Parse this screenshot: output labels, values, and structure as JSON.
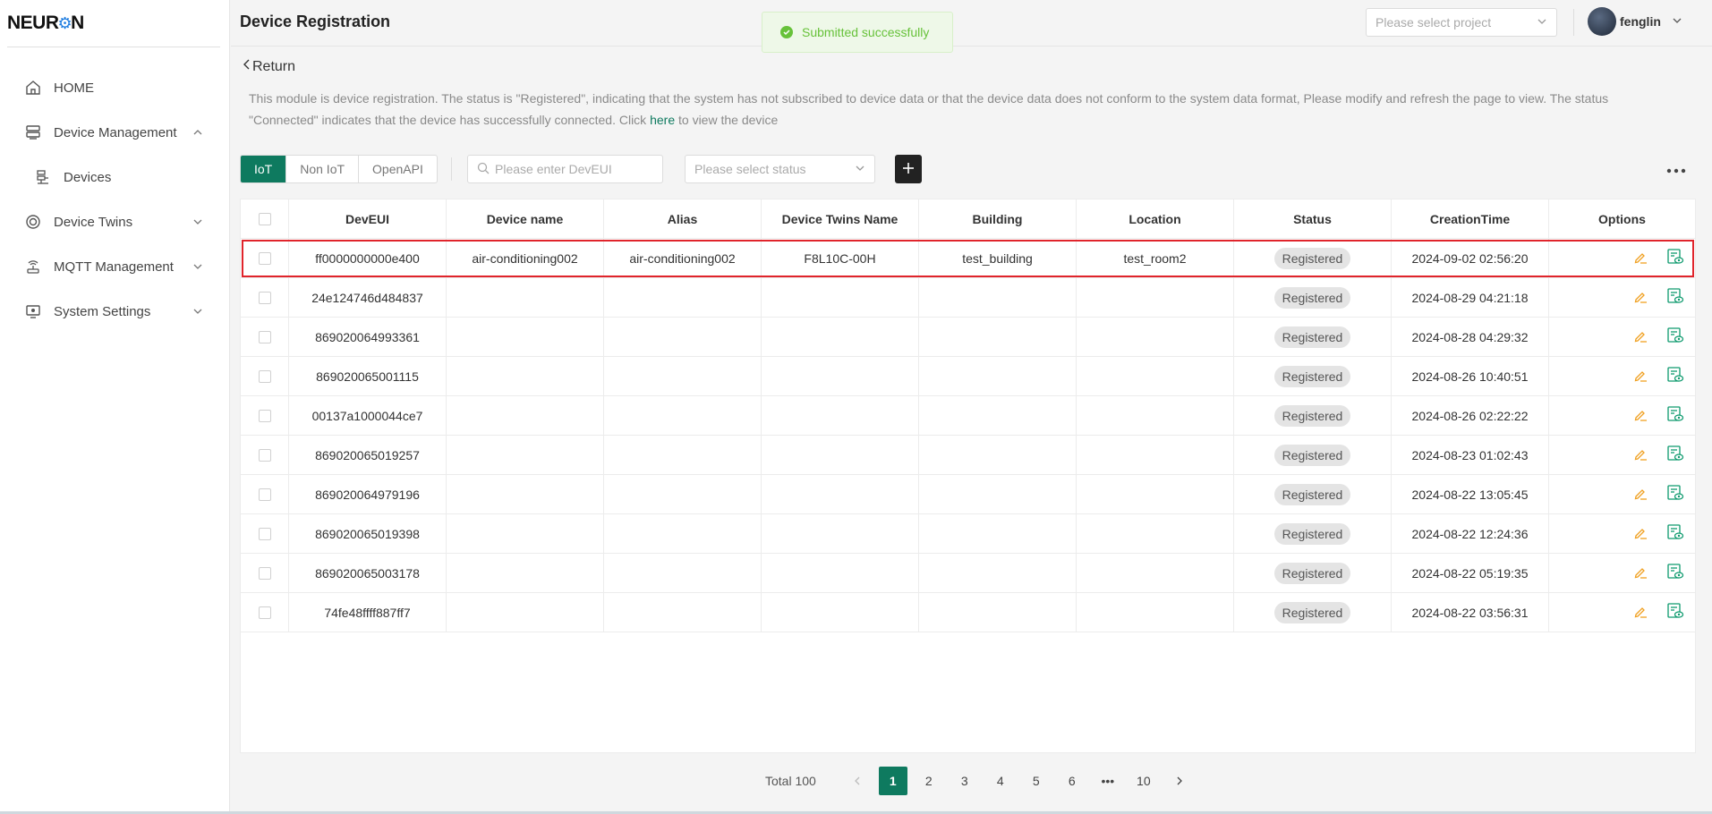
{
  "sidebar": {
    "logo": {
      "pre": "NEUR",
      "mark": "⚙",
      "post": "N"
    },
    "items": [
      {
        "label": "HOME",
        "icon": "home-icon"
      },
      {
        "label": "Device Management",
        "icon": "server-icon",
        "expanded": true
      },
      {
        "label": "Devices",
        "icon": "devices-icon",
        "sub": true
      },
      {
        "label": "Device Twins",
        "icon": "twins-icon"
      },
      {
        "label": "MQTT Management",
        "icon": "antenna-icon"
      },
      {
        "label": "System Settings",
        "icon": "monitor-icon"
      }
    ]
  },
  "header": {
    "title": "Device Registration",
    "project_placeholder": "Please select project",
    "username": "fenglin"
  },
  "toast": {
    "message": "Submitted successfully",
    "color": "#67c23a"
  },
  "content": {
    "back_label": "Return",
    "notice_pre": "This module is device registration. The status is \"Registered\", indicating that the system has not subscribed to device data or that the device data does not conform to the system data format, Please modify and refresh the page to view. The status \"Connected\" indicates that the device has successfully connected. Click ",
    "notice_link": "here",
    "notice_post": " to view the device"
  },
  "toolbar": {
    "tabs": [
      "IoT",
      "Non IoT",
      "OpenAPI"
    ],
    "active_tab": "IoT",
    "search_placeholder": "Please enter DevEUI",
    "status_placeholder": "Please select status"
  },
  "table": {
    "columns": [
      "DevEUI",
      "Device name",
      "Alias",
      "Device Twins Name",
      "Building",
      "Location",
      "Status",
      "CreationTime",
      "Options"
    ],
    "rows": [
      {
        "deveui": "ff0000000000e400",
        "name": "air-conditioning002",
        "alias": "air-conditioning002",
        "twins": "F8L10C-00H",
        "building": "test_building",
        "location": "test_room2",
        "status": "Registered",
        "time": "2024-09-02 02:56:20"
      },
      {
        "deveui": "24e124746d484837",
        "name": "",
        "alias": "",
        "twins": "",
        "building": "",
        "location": "",
        "status": "Registered",
        "time": "2024-08-29 04:21:18"
      },
      {
        "deveui": "869020064993361",
        "name": "",
        "alias": "",
        "twins": "",
        "building": "",
        "location": "",
        "status": "Registered",
        "time": "2024-08-28 04:29:32"
      },
      {
        "deveui": "869020065001115",
        "name": "",
        "alias": "",
        "twins": "",
        "building": "",
        "location": "",
        "status": "Registered",
        "time": "2024-08-26 10:40:51"
      },
      {
        "deveui": "00137a1000044ce7",
        "name": "",
        "alias": "",
        "twins": "",
        "building": "",
        "location": "",
        "status": "Registered",
        "time": "2024-08-26 02:22:22"
      },
      {
        "deveui": "869020065019257",
        "name": "",
        "alias": "",
        "twins": "",
        "building": "",
        "location": "",
        "status": "Registered",
        "time": "2024-08-23 01:02:43"
      },
      {
        "deveui": "869020064979196",
        "name": "",
        "alias": "",
        "twins": "",
        "building": "",
        "location": "",
        "status": "Registered",
        "time": "2024-08-22 13:05:45"
      },
      {
        "deveui": "869020065019398",
        "name": "",
        "alias": "",
        "twins": "",
        "building": "",
        "location": "",
        "status": "Registered",
        "time": "2024-08-22 12:24:36"
      },
      {
        "deveui": "869020065003178",
        "name": "",
        "alias": "",
        "twins": "",
        "building": "",
        "location": "",
        "status": "Registered",
        "time": "2024-08-22 05:19:35"
      },
      {
        "deveui": "74fe48ffff887ff7",
        "name": "",
        "alias": "",
        "twins": "",
        "building": "",
        "location": "",
        "status": "Registered",
        "time": "2024-08-22 03:56:31"
      }
    ],
    "highlighted_row": 0
  },
  "pagination": {
    "total_label": "Total 100",
    "pages": [
      "1",
      "2",
      "3",
      "4",
      "5",
      "6",
      "•••",
      "10"
    ],
    "current": "1"
  },
  "colors": {
    "accent": "#0e7a5f",
    "edit_icon": "#f0a020",
    "view_icon": "#0e9a6e",
    "highlight": "#e0242b"
  }
}
